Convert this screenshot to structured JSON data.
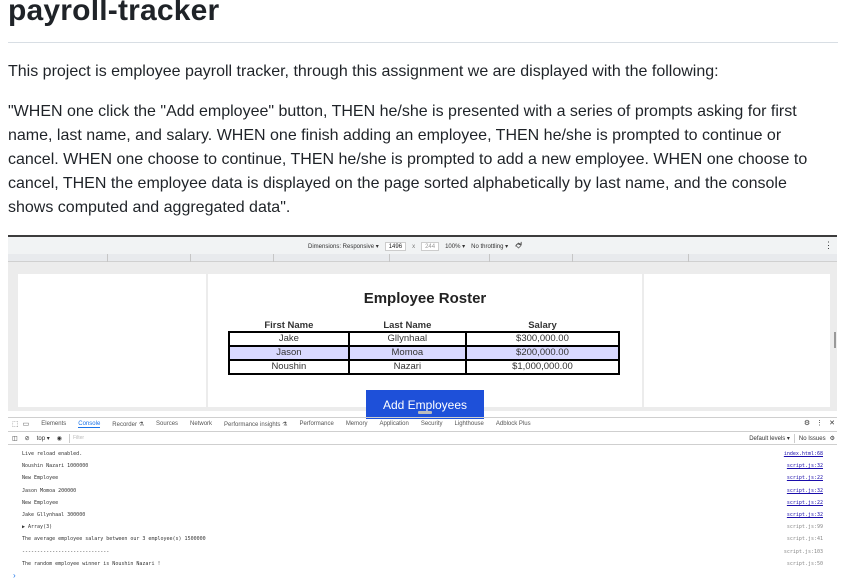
{
  "readme": {
    "title": "payroll-tracker",
    "intro": "This project is employee payroll tracker, through this assignment we are displayed with the following:",
    "quote": "\"WHEN one click the \"Add employee\" button, THEN he/she is presented with a series of prompts asking for first name, last name, and salary. WHEN one finish adding an employee, THEN he/she is prompted to continue or cancel. WHEN one choose to continue, THEN he/she is prompted to add a new employee. WHEN one choose to cancel, THEN the employee data is displayed on the page sorted alphabetically by last name, and the console shows computed and aggregated data\"."
  },
  "device_toolbar": {
    "dimensions": "Dimensions: Responsive ▾",
    "width": "1496",
    "times": "x",
    "height": "244",
    "zoom": "100% ▾",
    "throttling": "No throttling ▾",
    "rotate_icon": "rotate-icon",
    "menu_icon": "kebab-icon"
  },
  "app": {
    "title": "Employee Roster",
    "columns": [
      "First Name",
      "Last Name",
      "Salary"
    ],
    "rows": [
      [
        "Jake",
        "Gllynhaal",
        "$300,000.00"
      ],
      [
        "Jason",
        "Momoa",
        "$200,000.00"
      ],
      [
        "Noushin",
        "Nazari",
        "$1,000,000.00"
      ]
    ],
    "add_button": "Add Employees",
    "highlight_color": "#d9d9ff",
    "button_color": "#1e50d9"
  },
  "devtools": {
    "tabs": [
      "Elements",
      "Console",
      "Recorder ⚗",
      "Sources",
      "Network",
      "Performance insights ⚗",
      "Performance",
      "Memory",
      "Application",
      "Security",
      "Lighthouse",
      "Adblock Plus"
    ],
    "active_tab": "Console",
    "console_bar": {
      "context": "top ▾",
      "filter_placeholder": "Filter",
      "levels": "Default levels ▾",
      "issues": "No Issues"
    },
    "accent_color": "#1a73e8"
  },
  "console": {
    "lines": [
      {
        "text": "Live reload enabled.",
        "src": "index.html:68",
        "link": true
      },
      {
        "text": "Noushin Nazari 1000000",
        "src": "script.js:32",
        "link": true
      },
      {
        "text": "New Employee",
        "src": "script.js:22",
        "link": true
      },
      {
        "text": "Jason Momoa 200000",
        "src": "script.js:32",
        "link": true
      },
      {
        "text": "New Employee",
        "src": "script.js:22",
        "link": true
      },
      {
        "text": "Jake Gllynhaal 300000",
        "src": "script.js:32",
        "link": true
      },
      {
        "text": "▶ Array(3)",
        "src": "script.js:99",
        "link": false
      },
      {
        "text": "The average employee salary between our 3 employee(s) 1500000",
        "src": "script.js:41",
        "link": false
      },
      {
        "text": "-----------------------------",
        "src": "script.js:103",
        "link": false
      },
      {
        "text": "The random employee winner is Noushin Nazari !",
        "src": "script.js:50",
        "link": false
      }
    ],
    "prompt": "›"
  }
}
